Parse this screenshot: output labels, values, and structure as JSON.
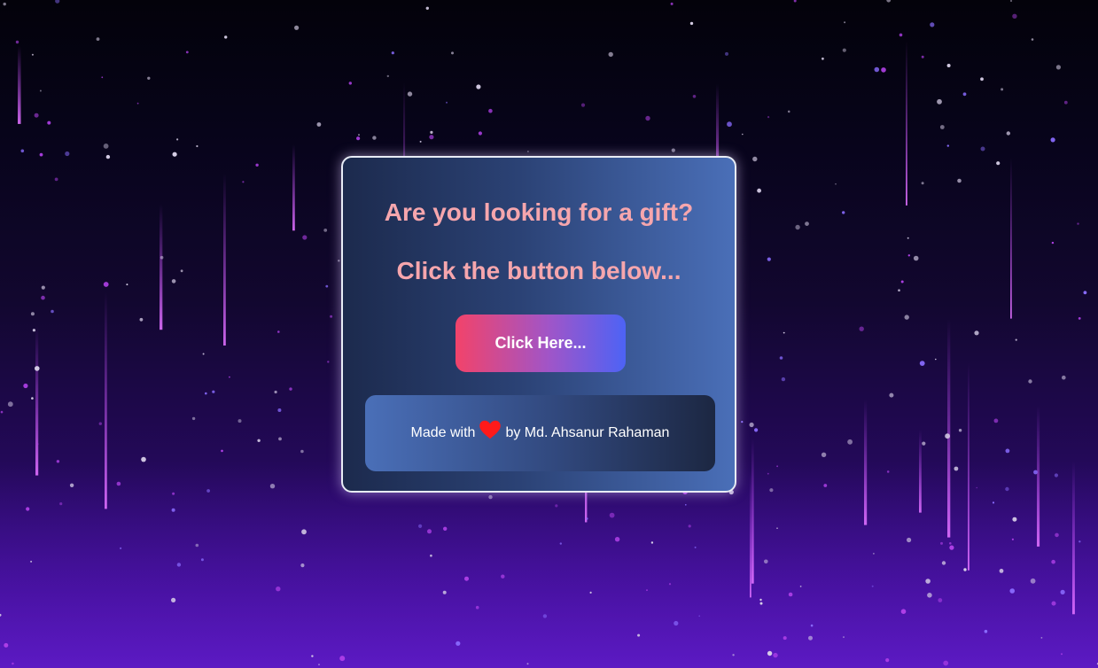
{
  "card": {
    "heading_line1": "Are you looking for a gift?",
    "heading_line2": "Click the button below...",
    "button_label": "Click Here...",
    "footer": {
      "prefix": "Made with",
      "suffix": "by Md. Ahsanur Rahaman",
      "icon": "heart-icon"
    }
  },
  "colors": {
    "heading": "#f6a6ad",
    "heart": "#ff1a1a",
    "button_gradient": [
      "#f2436a",
      "#4d63f5"
    ]
  }
}
